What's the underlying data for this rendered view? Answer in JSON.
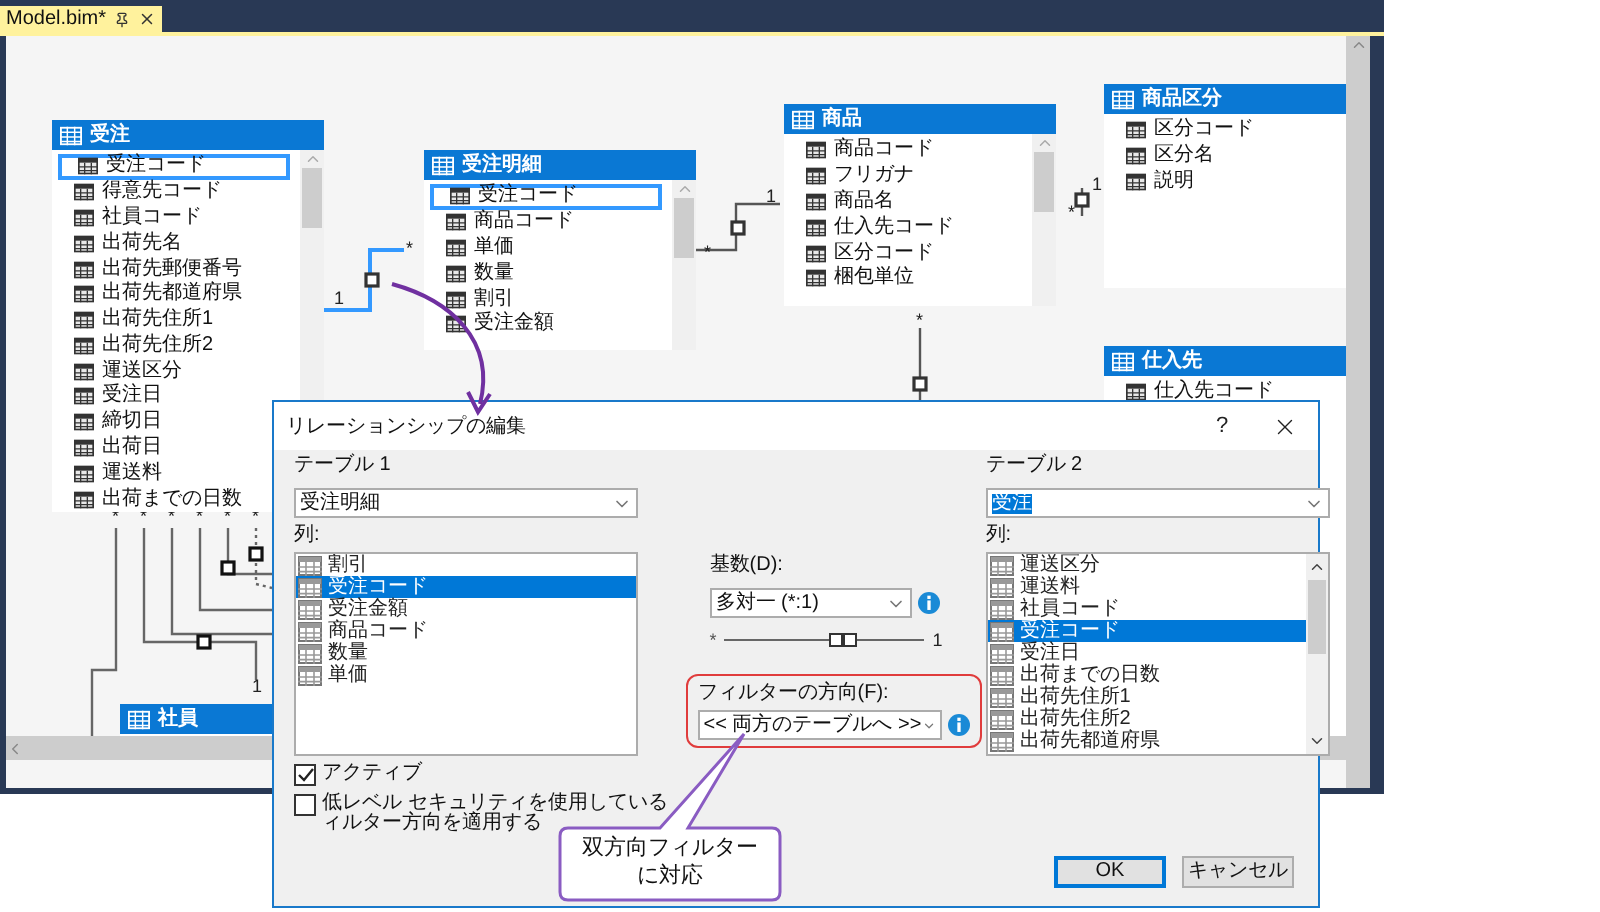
{
  "document_tab": {
    "label": "Model.bim*",
    "active": true
  },
  "tables": [
    {
      "name": "受注",
      "columns": [
        {
          "label": "受注コード",
          "selected": true
        },
        {
          "label": "得意先コード",
          "selected": false
        },
        {
          "label": "社員コード",
          "selected": false
        },
        {
          "label": "出荷先名",
          "selected": false
        },
        {
          "label": "出荷先郵便番号",
          "selected": false
        },
        {
          "label": "出荷先都道府県",
          "selected": false
        },
        {
          "label": "出荷先住所1",
          "selected": false
        },
        {
          "label": "出荷先住所2",
          "selected": false
        },
        {
          "label": "運送区分",
          "selected": false
        },
        {
          "label": "受注日",
          "selected": false
        },
        {
          "label": "締切日",
          "selected": false
        },
        {
          "label": "出荷日",
          "selected": false
        },
        {
          "label": "運送料",
          "selected": false
        },
        {
          "label": "出荷までの日数",
          "selected": false
        }
      ]
    },
    {
      "name": "受注明細",
      "columns": [
        {
          "label": "受注コード",
          "selected": true
        },
        {
          "label": "商品コード",
          "selected": false
        },
        {
          "label": "単価",
          "selected": false
        },
        {
          "label": "数量",
          "selected": false
        },
        {
          "label": "割引",
          "selected": false
        },
        {
          "label": "受注金額",
          "selected": false
        }
      ]
    },
    {
      "name": "商品",
      "columns": [
        {
          "label": "商品コード",
          "selected": false
        },
        {
          "label": "フリガナ",
          "selected": false
        },
        {
          "label": "商品名",
          "selected": false
        },
        {
          "label": "仕入先コード",
          "selected": false
        },
        {
          "label": "区分コード",
          "selected": false
        },
        {
          "label": "梱包単位",
          "selected": false
        }
      ]
    },
    {
      "name": "商品区分",
      "columns": [
        {
          "label": "区分コード",
          "selected": false
        },
        {
          "label": "区分名",
          "selected": false
        },
        {
          "label": "説明",
          "selected": false
        }
      ]
    },
    {
      "name": "仕入先",
      "columns": [
        {
          "label": "仕入先コード",
          "selected": false
        }
      ]
    },
    {
      "name": "社員"
    }
  ],
  "connectors": [
    {
      "start": "1",
      "end": "*",
      "selected": true
    },
    {
      "start": "*",
      "end": "1",
      "selected": false
    },
    {
      "start": "*",
      "end": "1",
      "selected": false
    },
    {
      "start": "*",
      "selected": false
    }
  ],
  "bottom_connector_marks": [
    "*",
    "*",
    "*",
    "*",
    "*",
    "*",
    "1"
  ],
  "dialog": {
    "title": "リレーションシップの編集",
    "help": "?",
    "table_1": {
      "label": "テーブル 1",
      "value": "受注明細",
      "value_highlighted": false,
      "columns_label": "列:",
      "columns": [
        {
          "label": "割引",
          "selected": false
        },
        {
          "label": "受注コード",
          "selected": true
        },
        {
          "label": "受注金額",
          "selected": false
        },
        {
          "label": "商品コード",
          "selected": false
        },
        {
          "label": "数量",
          "selected": false
        },
        {
          "label": "単価",
          "selected": false
        }
      ]
    },
    "table_2": {
      "label": "テーブル 2",
      "value": "受注",
      "value_highlighted": true,
      "columns_label": "列:",
      "columns": [
        {
          "label": "運送区分",
          "selected": false
        },
        {
          "label": "運送料",
          "selected": false
        },
        {
          "label": "社員コード",
          "selected": false
        },
        {
          "label": "受注コード",
          "selected": true
        },
        {
          "label": "受注日",
          "selected": false
        },
        {
          "label": "出荷までの日数",
          "selected": false
        },
        {
          "label": "出荷先住所1",
          "selected": false
        },
        {
          "label": "出荷先住所2",
          "selected": false
        },
        {
          "label": "出荷先都道府県",
          "selected": false
        }
      ]
    },
    "cardinality": {
      "label": "基数(D):",
      "value": "多対一 (*:1)"
    },
    "cardinality_line": {
      "start": "*",
      "end": "1"
    },
    "filter_direction": {
      "label": "フィルターの方向(F):",
      "value": "<< 両方のテーブルへ >>",
      "highlighted": true
    },
    "checkboxes": [
      {
        "lines": [
          "アクティブ"
        ],
        "checked": true
      },
      {
        "lines": [
          "低レベル セキュリティを使用している",
          "ィルター方向を適用する"
        ],
        "checked": false
      }
    ],
    "buttons": [
      {
        "label": "OK",
        "default": true
      },
      {
        "label": "キャンセル",
        "default": false
      }
    ]
  },
  "callout": {
    "lines": [
      "双方向フィルター",
      "に対応"
    ]
  }
}
